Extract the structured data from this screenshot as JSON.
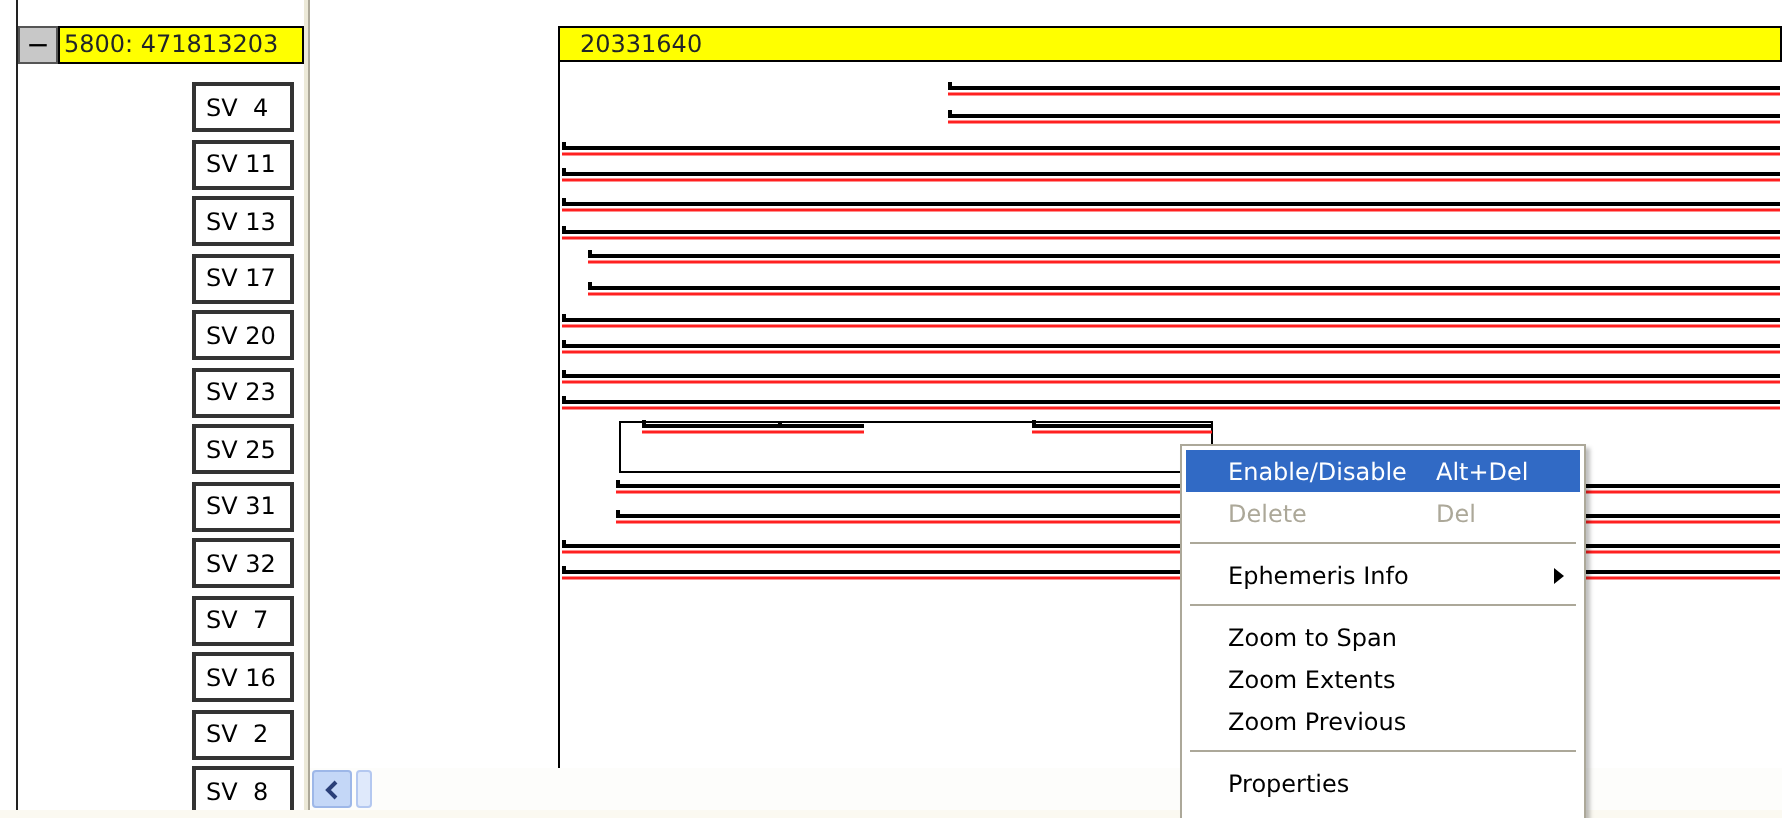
{
  "group": {
    "toggle": "−",
    "title": "5800: 471813203"
  },
  "satellites": [
    {
      "label": "SV  4"
    },
    {
      "label": "SV 11"
    },
    {
      "label": "SV 13"
    },
    {
      "label": "SV 17"
    },
    {
      "label": "SV 20"
    },
    {
      "label": "SV 23"
    },
    {
      "label": "SV 25"
    },
    {
      "label": "SV 31"
    },
    {
      "label": "SV 32"
    },
    {
      "label": "SV  7"
    },
    {
      "label": "SV 16"
    },
    {
      "label": "SV  2"
    },
    {
      "label": "SV  8"
    }
  ],
  "timeline": {
    "title": "20331640"
  },
  "context_menu": [
    {
      "kind": "item",
      "label": "Enable/Disable",
      "shortcut": "Alt+Del",
      "selected": true,
      "disabled": false
    },
    {
      "kind": "item",
      "label": "Delete",
      "shortcut": "Del",
      "selected": false,
      "disabled": true
    },
    {
      "kind": "separator"
    },
    {
      "kind": "submenu",
      "label": "Ephemeris Info",
      "selected": false,
      "disabled": false
    },
    {
      "kind": "separator"
    },
    {
      "kind": "item",
      "label": "Zoom to Span",
      "selected": false,
      "disabled": false
    },
    {
      "kind": "item",
      "label": "Zoom Extents",
      "selected": false,
      "disabled": false
    },
    {
      "kind": "item",
      "label": "Zoom Previous",
      "selected": false,
      "disabled": false
    },
    {
      "kind": "separator"
    },
    {
      "kind": "item",
      "label": "Properties",
      "selected": false,
      "disabled": false
    }
  ]
}
